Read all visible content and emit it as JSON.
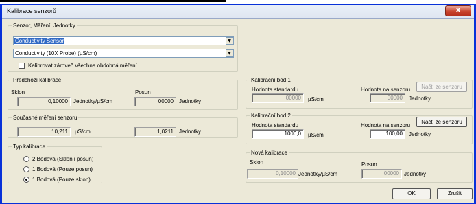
{
  "window": {
    "title": "Kalibrace senzorů",
    "close_glyph": "X"
  },
  "sensor_group": {
    "legend": "Senzor, Měření, Jednotky",
    "sensor_select": "Conductivity Sensor",
    "measurement_select": "Conductivity (10X Probe) (µS/cm)",
    "calibrate_all_label": "Kalibrovat zároveň všechna obdobná měření.",
    "calibrate_all_checked": false
  },
  "previous_calibration": {
    "legend": "Předchozí kalibrace",
    "slope_label": "Sklon",
    "slope_value": "0,10000",
    "slope_unit": "Jednotky/µS/cm",
    "offset_label": "Posun",
    "offset_value": "00000",
    "offset_unit": "Jednotky"
  },
  "current_measurement": {
    "legend": "Současné měření senzoru",
    "value1": "10,211",
    "unit1": "µS/cm",
    "value2": "1,0211",
    "unit2": "Jednotky"
  },
  "calibration_type": {
    "legend": "Typ kalibrace",
    "options": [
      {
        "label": "2 Bodová (Sklon i posun)",
        "selected": false
      },
      {
        "label": "1 Bodová (Pouze posun)",
        "selected": false
      },
      {
        "label": "1 Bodová (Pouze sklon)",
        "selected": true
      }
    ]
  },
  "cal_point_1": {
    "legend": "Kalibrační bod 1",
    "standard_label": "Hodnota standardu",
    "standard_value": "00000",
    "standard_unit": "µS/cm",
    "sensor_label": "Hodnota na senzoru",
    "sensor_value": "00000",
    "sensor_unit": "Jednotky",
    "read_button": "Načti ze senzoru",
    "enabled": false
  },
  "cal_point_2": {
    "legend": "Kalibrační bod 2",
    "standard_label": "Hodnota standardu",
    "standard_value": "1000,0",
    "standard_unit": "µS/cm",
    "sensor_label": "Hodnota na senzoru",
    "sensor_value": "100,00",
    "sensor_unit": "Jednotky",
    "read_button": "Načti ze senzoru",
    "enabled": true
  },
  "new_calibration": {
    "legend": "Nová kalibrace",
    "slope_label": "Sklon",
    "slope_value": "0,10000",
    "slope_unit": "Jednotky/µS/cm",
    "offset_label": "Posun",
    "offset_value": "00000",
    "offset_unit": "Jednotky"
  },
  "buttons": {
    "ok": "OK",
    "cancel": "Zrušit"
  },
  "colors": {
    "title_accent": "#0831d9",
    "selection": "#316ac5",
    "close": "#c8442c"
  }
}
